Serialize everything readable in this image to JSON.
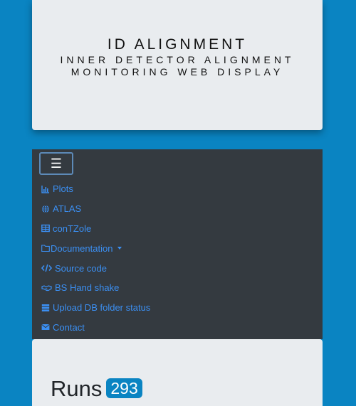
{
  "header": {
    "title": "ID ALIGNMENT",
    "subtitle_line1": "INNER DETECTOR ALIGNMENT",
    "subtitle_line2": "MONITORING WEB DISPLAY"
  },
  "navbar": {
    "toggler_icon": "hamburger-icon",
    "toggler_glyph": "☰",
    "items": [
      {
        "label": "Plots",
        "icon": "bar-chart-icon"
      },
      {
        "label": "ATLAS",
        "icon": "globe-icon"
      },
      {
        "label": "conTZole",
        "icon": "table-icon"
      },
      {
        "label": "Documentation",
        "icon": "folder-icon",
        "dropdown": true
      },
      {
        "label": "Source code",
        "icon": "code-icon"
      },
      {
        "label": "BS Hand shake",
        "icon": "handshake-icon"
      },
      {
        "label": "Upload DB folder status",
        "icon": "database-icon"
      },
      {
        "label": "Contact",
        "icon": "envelope-icon"
      }
    ]
  },
  "main": {
    "heading": "Runs",
    "badge": "293"
  },
  "colors": {
    "background": "#0a84c2",
    "card": "#e9ecef",
    "navbar": "#343a40",
    "link": "#3b8ff2",
    "badge": "#0a84c2"
  }
}
